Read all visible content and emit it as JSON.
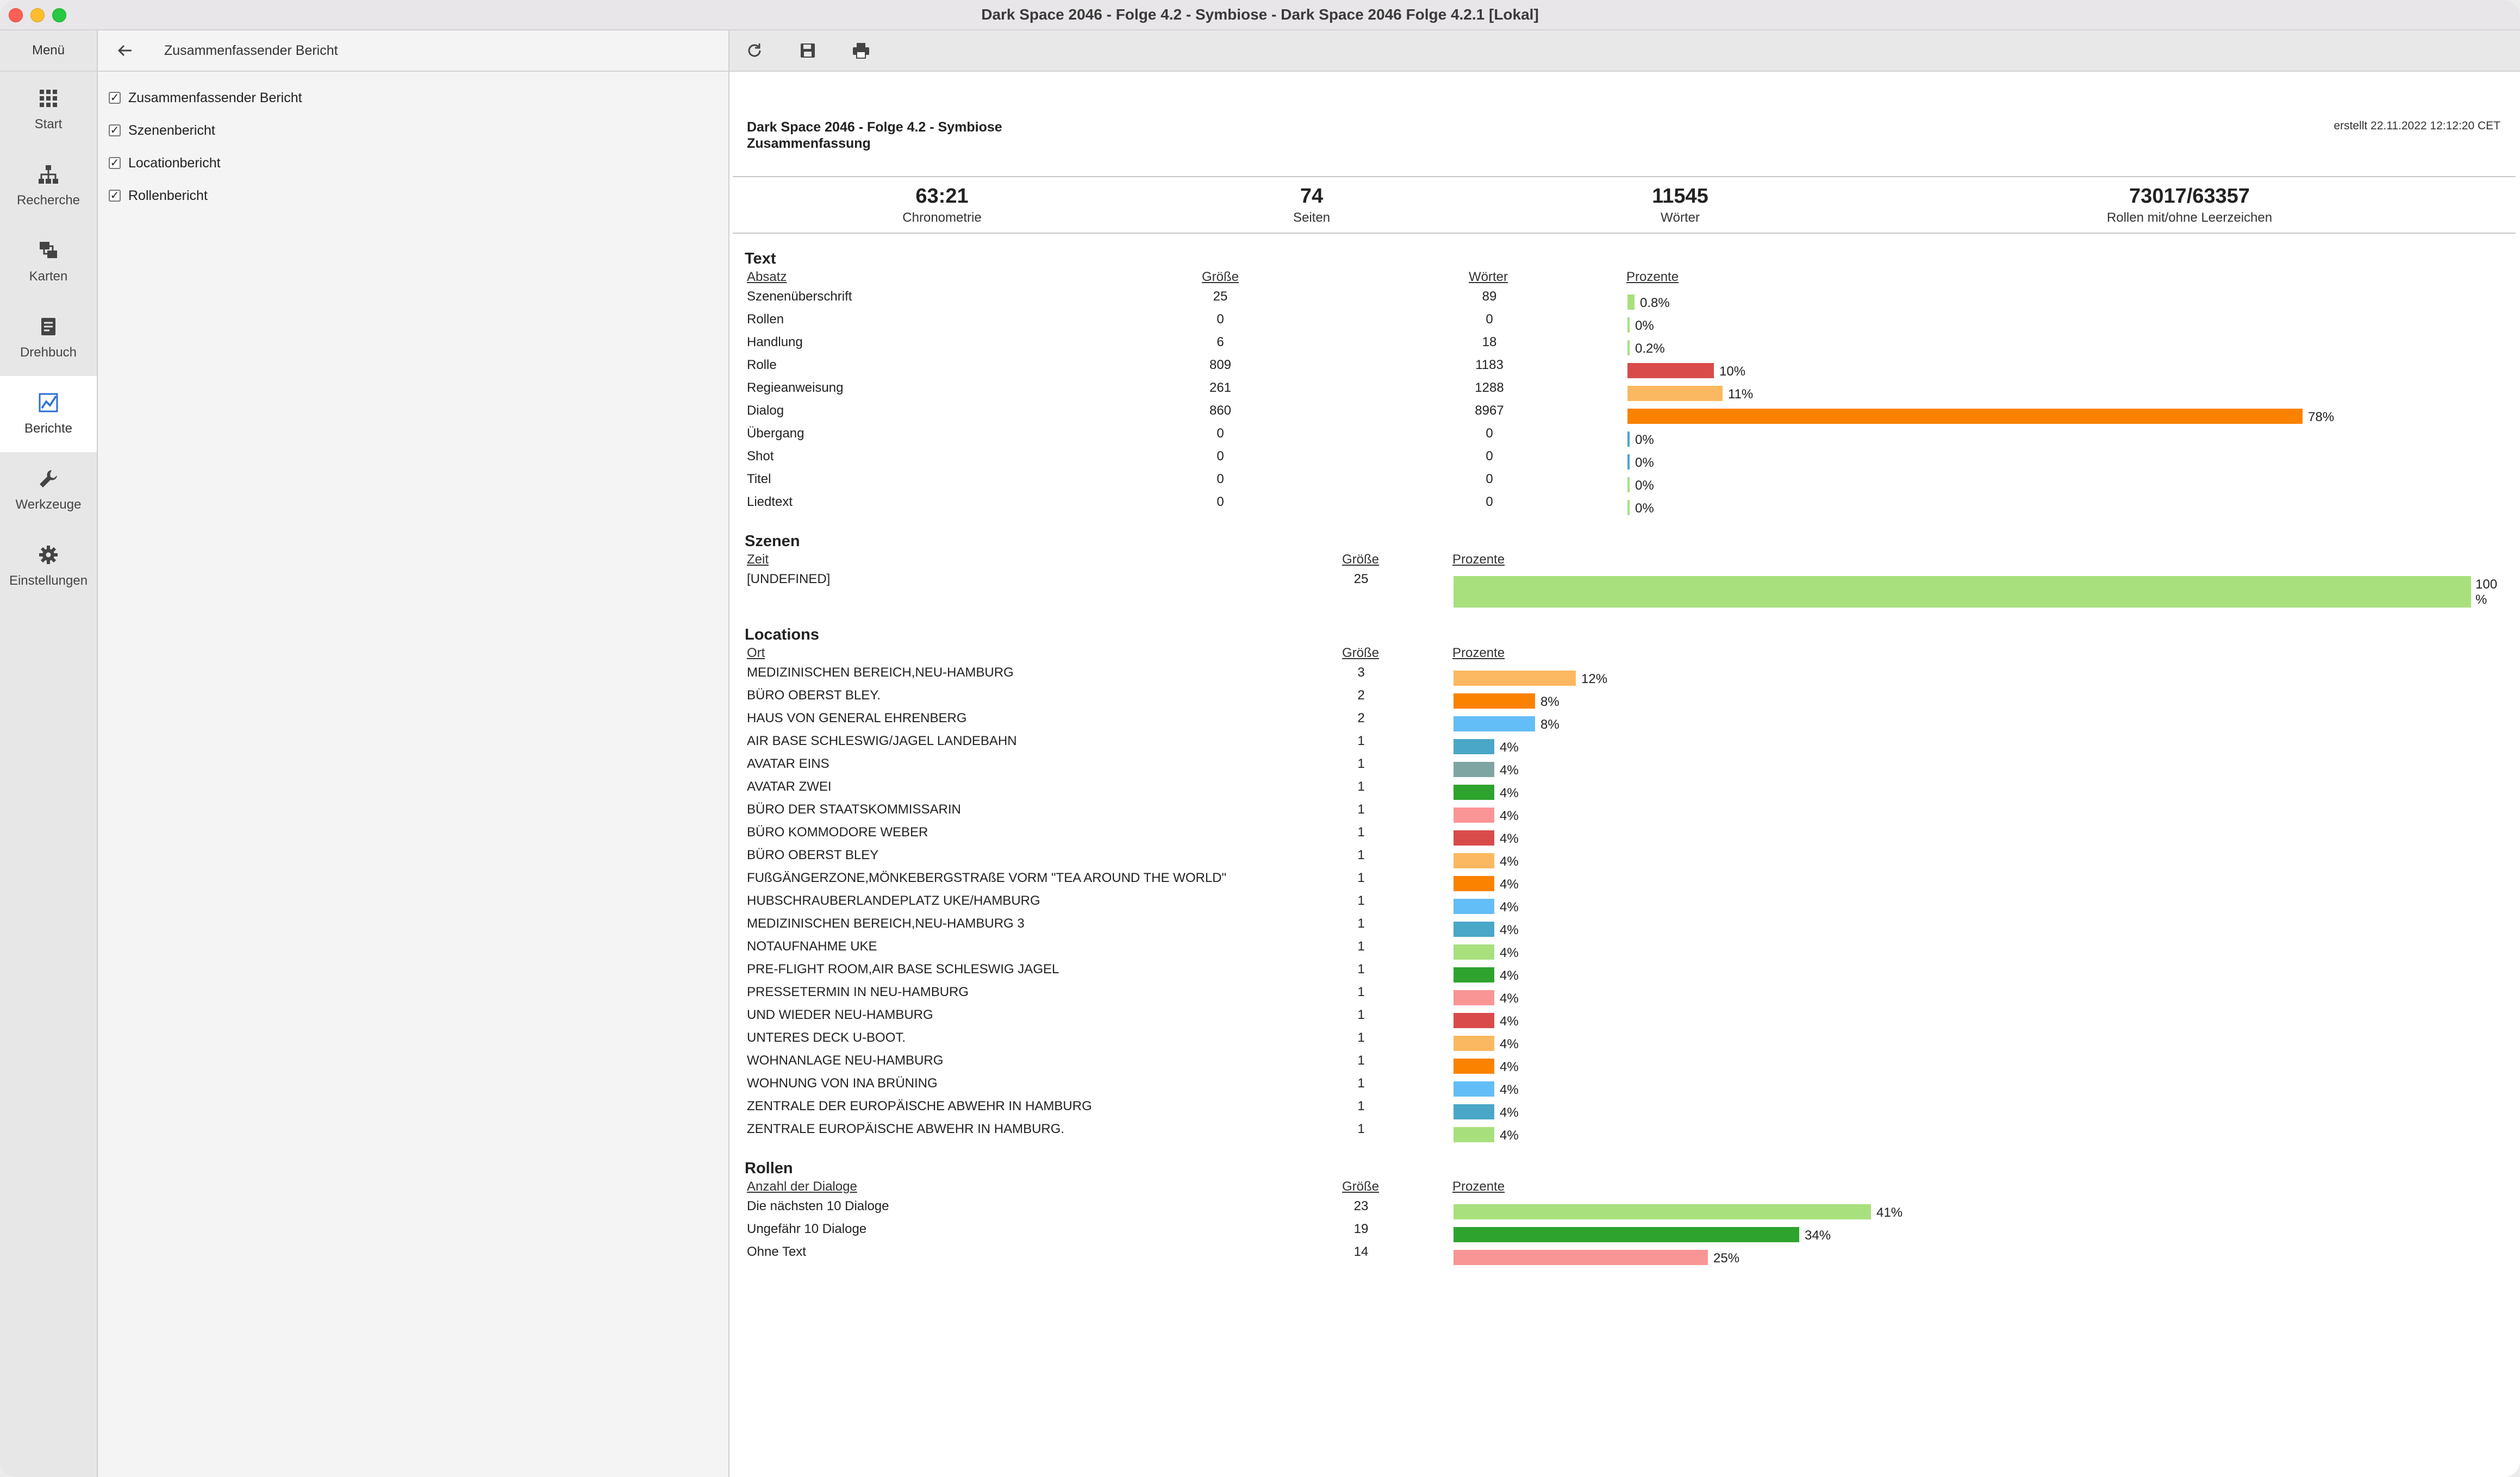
{
  "window": {
    "title": "Dark Space 2046 - Folge 4.2 - Symbiose - Dark Space 2046 Folge 4.2.1 [Lokal]"
  },
  "nav": {
    "menu": "Menü",
    "items": [
      {
        "label": "Start",
        "icon": "grid-icon"
      },
      {
        "label": "Recherche",
        "icon": "hierarchy-icon"
      },
      {
        "label": "Karten",
        "icon": "cards-icon"
      },
      {
        "label": "Drehbuch",
        "icon": "document-icon"
      },
      {
        "label": "Berichte",
        "icon": "chart-icon",
        "active": true
      },
      {
        "label": "Werkzeuge",
        "icon": "wrench-icon"
      },
      {
        "label": "Einstellungen",
        "icon": "gear-icon"
      }
    ]
  },
  "side": {
    "title": "Zusammenfassender Bericht",
    "checks": [
      {
        "label": "Zusammenfassender Bericht",
        "checked": true
      },
      {
        "label": "Szenenbericht",
        "checked": true
      },
      {
        "label": "Locationbericht",
        "checked": true
      },
      {
        "label": "Rollenbericht",
        "checked": true
      }
    ]
  },
  "report": {
    "title": "Dark Space 2046 - Folge 4.2 - Symbiose",
    "subtitle": "Zusammenfassung",
    "created": "erstellt 22.11.2022 12:12:20 CET",
    "stats": [
      {
        "value": "63:21",
        "label": "Chronometrie"
      },
      {
        "value": "74",
        "label": "Seiten"
      },
      {
        "value": "11545",
        "label": "Wörter"
      },
      {
        "value": "73017/63357",
        "label": "Rollen mit/ohne Leerzeichen"
      }
    ],
    "text": {
      "heading": "Text",
      "cols": [
        "Absatz",
        "Größe",
        "Wörter",
        "Prozente"
      ],
      "rows": [
        {
          "label": "Szenenüberschrift",
          "size": "25",
          "words": "89",
          "percent": 0.8,
          "pct_label": "0.8%",
          "color": "#a8e07d"
        },
        {
          "label": "Rollen",
          "size": "0",
          "words": "0",
          "percent": 0,
          "pct_label": "0%",
          "color": "#a8e07d"
        },
        {
          "label": "Handlung",
          "size": "6",
          "words": "18",
          "percent": 0.2,
          "pct_label": "0.2%",
          "color": "#a8e07d"
        },
        {
          "label": "Rolle",
          "size": "809",
          "words": "1183",
          "percent": 10,
          "pct_label": "10%",
          "color": "#d94b4b"
        },
        {
          "label": "Regieanweisung",
          "size": "261",
          "words": "1288",
          "percent": 11,
          "pct_label": "11%",
          "color": "#fcb860"
        },
        {
          "label": "Dialog",
          "size": "860",
          "words": "8967",
          "percent": 78,
          "pct_label": "78%",
          "color": "#fb8200"
        },
        {
          "label": "Übergang",
          "size": "0",
          "words": "0",
          "percent": 0,
          "pct_label": "0%",
          "color": "#4aa7c7"
        },
        {
          "label": "Shot",
          "size": "0",
          "words": "0",
          "percent": 0,
          "pct_label": "0%",
          "color": "#4aa7c7"
        },
        {
          "label": "Titel",
          "size": "0",
          "words": "0",
          "percent": 0,
          "pct_label": "0%",
          "color": "#a8e07d"
        },
        {
          "label": "Liedtext",
          "size": "0",
          "words": "0",
          "percent": 0,
          "pct_label": "0%",
          "color": "#a8e07d"
        }
      ]
    },
    "szenen": {
      "heading": "Szenen",
      "cols": [
        "Zeit",
        "Größe",
        "Prozente"
      ],
      "rows": [
        {
          "label": "[UNDEFINED]",
          "size": "25",
          "percent": 100,
          "pct_label_a": "100",
          "pct_label_b": "%",
          "color": "#a8e07d"
        }
      ]
    },
    "locations": {
      "heading": "Locations",
      "cols": [
        "Ort",
        "Größe",
        "Prozente"
      ],
      "rows": [
        {
          "label": "MEDIZINISCHEN BEREICH,NEU-HAMBURG",
          "size": "3",
          "percent": 12,
          "pct_label": "12%",
          "color": "#fcb860"
        },
        {
          "label": "BÜRO OBERST BLEY.",
          "size": "2",
          "percent": 8,
          "pct_label": "8%",
          "color": "#fb8200"
        },
        {
          "label": "HAUS VON GENERAL EHRENBERG",
          "size": "2",
          "percent": 8,
          "pct_label": "8%",
          "color": "#63bdf6"
        },
        {
          "label": "AIR BASE SCHLESWIG/JAGEL LANDEBAHN",
          "size": "1",
          "percent": 4,
          "pct_label": "4%",
          "color": "#4aa7c7"
        },
        {
          "label": "AVATAR EINS",
          "size": "1",
          "percent": 4,
          "pct_label": "4%",
          "color": "#7fa5a2"
        },
        {
          "label": "AVATAR ZWEI",
          "size": "1",
          "percent": 4,
          "pct_label": "4%",
          "color": "#2ea32e"
        },
        {
          "label": "BÜRO DER STAATSKOMMISSARIN",
          "size": "1",
          "percent": 4,
          "pct_label": "4%",
          "color": "#fa9595"
        },
        {
          "label": "BÜRO KOMMODORE WEBER",
          "size": "1",
          "percent": 4,
          "pct_label": "4%",
          "color": "#d94b4b"
        },
        {
          "label": "BÜRO OBERST BLEY",
          "size": "1",
          "percent": 4,
          "pct_label": "4%",
          "color": "#fcb860"
        },
        {
          "label": "FUßGÄNGERZONE,MÖNKEBERGSTRAßE VORM \"TEA AROUND THE WORLD\"",
          "size": "1",
          "percent": 4,
          "pct_label": "4%",
          "color": "#fb8200"
        },
        {
          "label": "HUBSCHRAUBERLANDEPLATZ UKE/HAMBURG",
          "size": "1",
          "percent": 4,
          "pct_label": "4%",
          "color": "#63bdf6"
        },
        {
          "label": "MEDIZINISCHEN BEREICH,NEU-HAMBURG 3",
          "size": "1",
          "percent": 4,
          "pct_label": "4%",
          "color": "#4aa7c7"
        },
        {
          "label": "NOTAUFNAHME UKE",
          "size": "1",
          "percent": 4,
          "pct_label": "4%",
          "color": "#a8e07d"
        },
        {
          "label": "PRE-FLIGHT ROOM,AIR BASE SCHLESWIG JAGEL",
          "size": "1",
          "percent": 4,
          "pct_label": "4%",
          "color": "#2ea32e"
        },
        {
          "label": "PRESSETERMIN IN NEU-HAMBURG",
          "size": "1",
          "percent": 4,
          "pct_label": "4%",
          "color": "#fa9595"
        },
        {
          "label": "UND WIEDER NEU-HAMBURG",
          "size": "1",
          "percent": 4,
          "pct_label": "4%",
          "color": "#d94b4b"
        },
        {
          "label": "UNTERES DECK U-BOOT.",
          "size": "1",
          "percent": 4,
          "pct_label": "4%",
          "color": "#fcb860"
        },
        {
          "label": "WOHNANLAGE NEU-HAMBURG",
          "size": "1",
          "percent": 4,
          "pct_label": "4%",
          "color": "#fb8200"
        },
        {
          "label": "WOHNUNG VON INA BRÜNING",
          "size": "1",
          "percent": 4,
          "pct_label": "4%",
          "color": "#63bdf6"
        },
        {
          "label": "ZENTRALE DER EUROPÄISCHE ABWEHR IN HAMBURG",
          "size": "1",
          "percent": 4,
          "pct_label": "4%",
          "color": "#4aa7c7"
        },
        {
          "label": "ZENTRALE EUROPÄISCHE ABWEHR IN HAMBURG.",
          "size": "1",
          "percent": 4,
          "pct_label": "4%",
          "color": "#a8e07d"
        }
      ]
    },
    "rollen": {
      "heading": "Rollen",
      "cols": [
        "Anzahl der Dialoge",
        "Größe",
        "Prozente"
      ],
      "rows": [
        {
          "label": "Die nächsten 10 Dialoge",
          "size": "23",
          "percent": 41,
          "pct_label": "41%",
          "color": "#a8e07d"
        },
        {
          "label": "Ungefähr 10 Dialoge",
          "size": "19",
          "percent": 34,
          "pct_label": "34%",
          "color": "#2ea32e"
        },
        {
          "label": "Ohne Text",
          "size": "14",
          "percent": 25,
          "pct_label": "25%",
          "color": "#fa9595"
        }
      ]
    }
  }
}
